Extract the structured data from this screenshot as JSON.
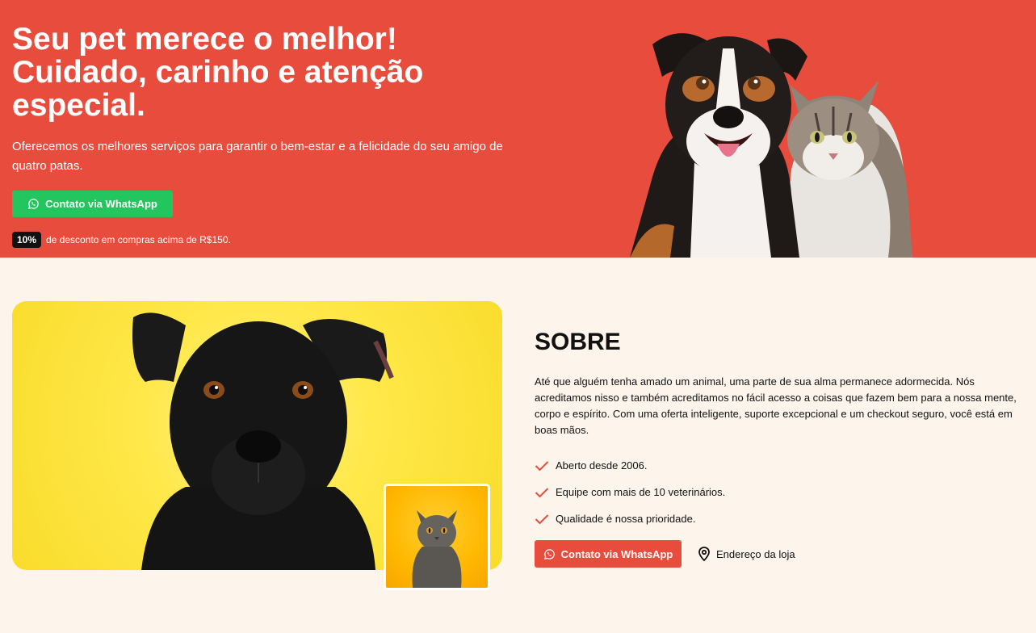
{
  "hero": {
    "title_line1": "Seu pet merece o melhor!",
    "title_line2": "Cuidado, carinho e atenção",
    "title_line3": "especial.",
    "subtitle": "Oferecemos os melhores serviços para garantir o bem-estar e a felicidade do seu amigo de quatro patas.",
    "cta_label": "Contato via WhatsApp",
    "discount_badge": "10%",
    "discount_text": "de desconto em compras acima de R$150.",
    "background_color": "#e84c3d",
    "cta_color": "#22c55e"
  },
  "about": {
    "title": "SOBRE",
    "text": "Até que alguém tenha amado um animal, uma parte de sua alma permanece adormecida. Nós acreditamos nisso e também acreditamos no fácil acesso a coisas que fazem bem para a nossa mente, corpo e espírito. Com uma oferta inteligente, suporte excepcional e um checkout seguro, você está em boas mãos.",
    "checklist": [
      "Aberto desde 2006.",
      "Equipe com mais de 10 veterinários.",
      "Qualidade é nossa prioridade."
    ],
    "cta_label": "Contato via WhatsApp",
    "address_label": "Endereço da loja",
    "accent_color": "#e84c3d"
  },
  "icons": {
    "whatsapp": "whatsapp-icon",
    "check": "check-icon",
    "location": "location-pin-icon"
  }
}
